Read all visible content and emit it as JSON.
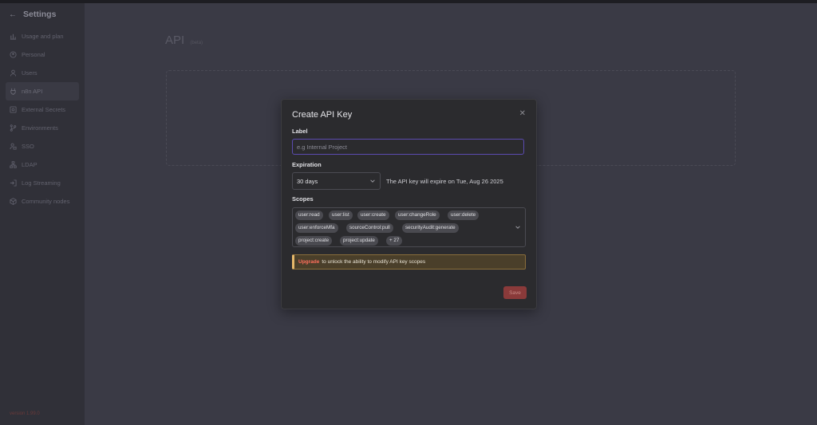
{
  "sidebar": {
    "title": "Settings",
    "items": [
      {
        "label": "Usage and plan",
        "icon": "chart-bar-icon"
      },
      {
        "label": "Personal",
        "icon": "user-circle-icon"
      },
      {
        "label": "Users",
        "icon": "user-icon"
      },
      {
        "label": "n8n API",
        "icon": "plug-icon"
      },
      {
        "label": "External Secrets",
        "icon": "vault-icon"
      },
      {
        "label": "Environments",
        "icon": "code-branch-icon"
      },
      {
        "label": "SSO",
        "icon": "user-lock-icon"
      },
      {
        "label": "LDAP",
        "icon": "network-icon"
      },
      {
        "label": "Log Streaming",
        "icon": "sign-in-icon"
      },
      {
        "label": "Community nodes",
        "icon": "cube-icon"
      }
    ],
    "version": "version 1.99.0"
  },
  "main": {
    "title": "API",
    "badge": "(beta)"
  },
  "modal": {
    "title": "Create API Key",
    "label_heading": "Label",
    "label_placeholder": "e.g Internal Project",
    "expiration_heading": "Expiration",
    "expiration_value": "30 days",
    "expiration_note": "The API key will expire on Tue, Aug 26 2025",
    "scopes_heading": "Scopes",
    "scopes": [
      "user:read",
      "user:list",
      "user:create",
      "user:changeRole",
      "user:delete",
      "user:enforceMfa",
      "sourceControl:pull",
      "securityAudit:generate",
      "project:create",
      "project:update",
      "+ 27"
    ],
    "banner_link": "Upgrade",
    "banner_text": "to unlock the ability to modify API key scopes",
    "save_label": "Save"
  },
  "colors": {
    "accent_border": "#5b4bb0",
    "save_button": "#8a3a3a",
    "banner_bg": "#4a3f2a",
    "upgrade_link": "#ff6f5c"
  }
}
